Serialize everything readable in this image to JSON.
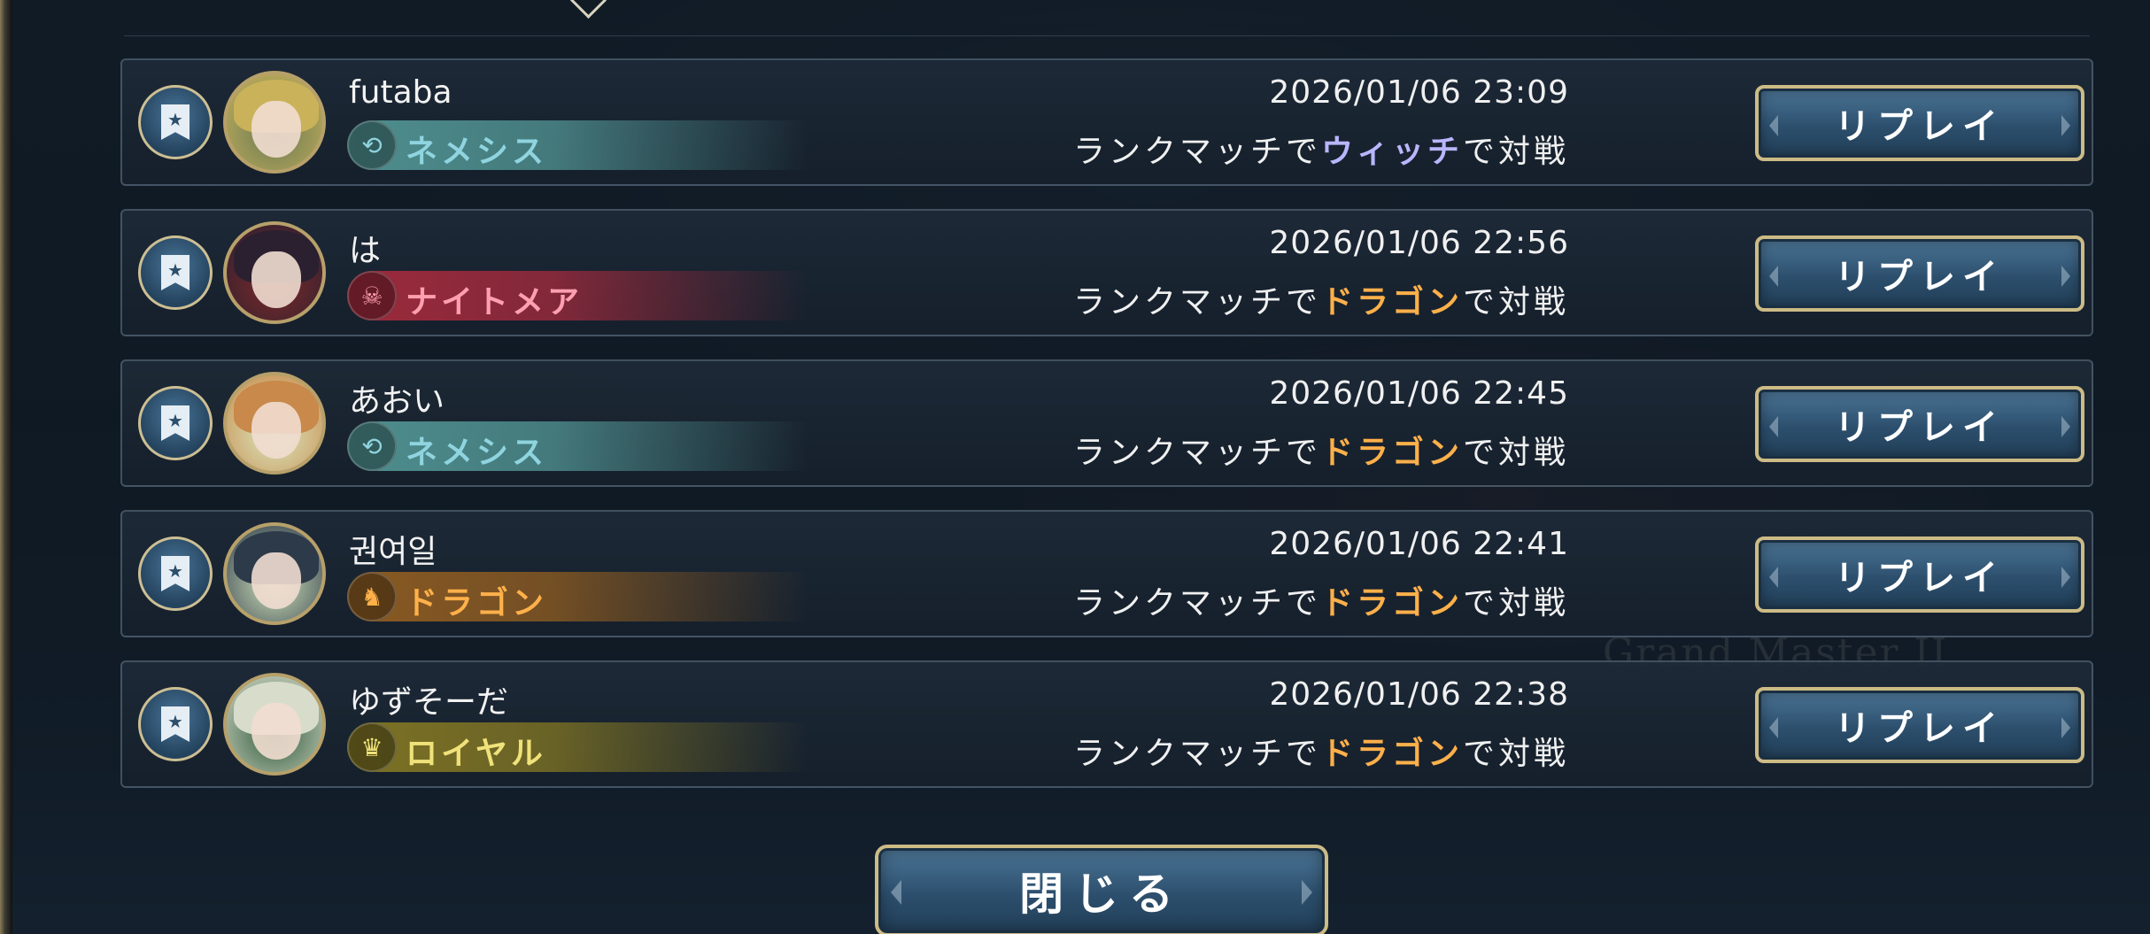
{
  "background_text": "Grand Master II",
  "rows": [
    {
      "player_name": "futaba",
      "class_name": "ネメシス",
      "class_icon": "nemesis-icon",
      "class_color": "#8fd4df",
      "bar_color": "#4f8f8f",
      "avatar_colors": [
        "#c9b25a",
        "#6b7a55"
      ],
      "datetime": "2026/01/06 23:09",
      "match_prefix": "ランクマッチで",
      "opponent_class": "ウィッチ",
      "opponent_color": "#b9b6ff",
      "match_suffix": "で対戦",
      "replay_label": "リプレイ"
    },
    {
      "player_name": "は",
      "class_name": "ナイトメア",
      "class_icon": "nightmare-icon",
      "class_color": "#ff9fb0",
      "bar_color": "#9c2a3c",
      "avatar_colors": [
        "#2b2030",
        "#7a2a2a"
      ],
      "datetime": "2026/01/06 22:56",
      "match_prefix": "ランクマッチで",
      "opponent_class": "ドラゴン",
      "opponent_color": "#ffb04a",
      "match_suffix": "で対戦",
      "replay_label": "リプレイ"
    },
    {
      "player_name": "あおい",
      "class_name": "ネメシス",
      "class_icon": "nemesis-icon",
      "class_color": "#8fd4df",
      "bar_color": "#4f8f8f",
      "avatar_colors": [
        "#c8894a",
        "#d9e8c0"
      ],
      "datetime": "2026/01/06 22:45",
      "match_prefix": "ランクマッチで",
      "opponent_class": "ドラゴン",
      "opponent_color": "#ffb04a",
      "match_suffix": "で対戦",
      "replay_label": "リプレイ"
    },
    {
      "player_name": "권여일",
      "class_name": "ドラゴン",
      "class_icon": "dragon-icon",
      "class_color": "#ffb04a",
      "bar_color": "#8a5a22",
      "avatar_colors": [
        "#2d3a4a",
        "#cfe0b8"
      ],
      "datetime": "2026/01/06 22:41",
      "match_prefix": "ランクマッチで",
      "opponent_class": "ドラゴン",
      "opponent_color": "#ffb04a",
      "match_suffix": "で対戦",
      "replay_label": "リプレイ"
    },
    {
      "player_name": "ゆずそーだ",
      "class_name": "ロイヤル",
      "class_icon": "royal-crown-icon",
      "class_color": "#f0e27a",
      "bar_color": "#7d7224",
      "avatar_colors": [
        "#d8dccb",
        "#2f5a3a"
      ],
      "datetime": "2026/01/06 22:38",
      "match_prefix": "ランクマッチで",
      "opponent_class": "ドラゴン",
      "opponent_color": "#ffb04a",
      "match_suffix": "で対戦",
      "replay_label": "リプレイ"
    }
  ],
  "close_label": "閉じる"
}
